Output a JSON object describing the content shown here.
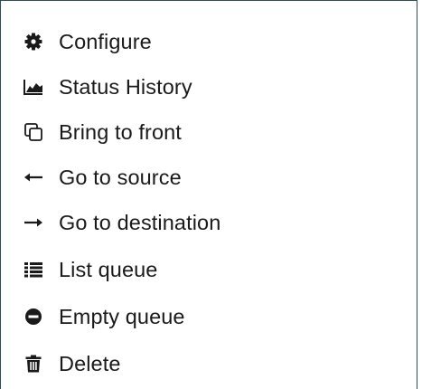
{
  "context_menu": {
    "items": [
      {
        "label": "Configure",
        "icon": "gear-icon"
      },
      {
        "label": "Status History",
        "icon": "area-chart-icon"
      },
      {
        "label": "Bring to front",
        "icon": "clone-icon"
      },
      {
        "label": "Go to source",
        "icon": "arrow-left-icon"
      },
      {
        "label": "Go to destination",
        "icon": "arrow-right-icon"
      },
      {
        "label": "List queue",
        "icon": "list-icon"
      },
      {
        "label": "Empty queue",
        "icon": "minus-circle-icon"
      },
      {
        "label": "Delete",
        "icon": "trash-icon"
      }
    ]
  },
  "colors": {
    "border": "#2b4d54",
    "text": "#1a1a1a",
    "icon": "#1a1a1a"
  }
}
